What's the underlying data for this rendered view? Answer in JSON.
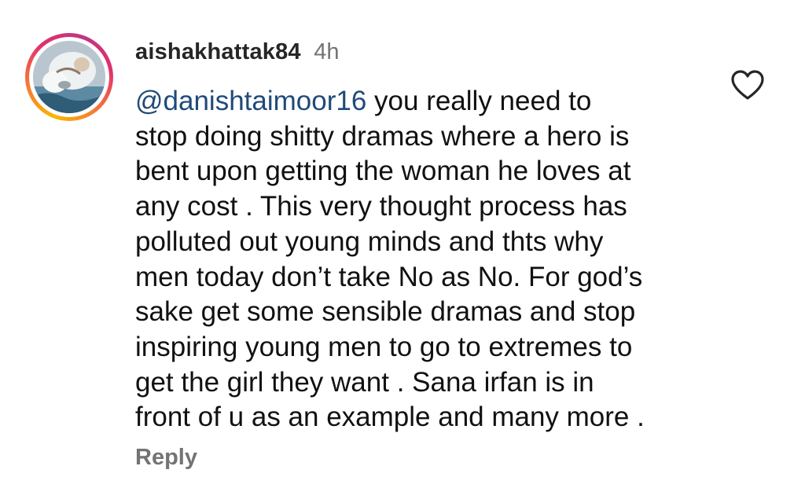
{
  "comment": {
    "username": "aishakhattak84",
    "timestamp": "4h",
    "mention": "@danishtaimoor16",
    "lines": [
      " you really need to",
      "stop doing shitty dramas where a hero is",
      "bent upon getting the woman he loves at",
      "any cost . This very thought process has",
      "polluted out young minds and thts why",
      "men today don’t take No as No. For god’s",
      "sake get some sensible dramas and stop",
      "inspiring young men to go to extremes to",
      "get the girl they want . Sana irfan is in",
      "front of u as an example and many more ."
    ],
    "reply_label": "Reply",
    "like_icon": "heart-outline-icon"
  },
  "colors": {
    "mention": "#1f4a7a",
    "username": "#262626",
    "secondary": "#737373",
    "ring_start": "#f7b800",
    "ring_end": "#c13584"
  }
}
